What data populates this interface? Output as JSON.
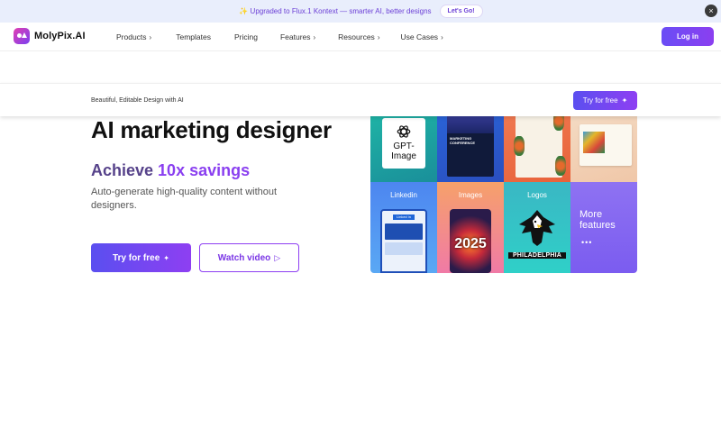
{
  "announcement": {
    "icon": "sparkles-icon",
    "text": "✨ Upgraded to Flux.1 Kontext — smarter AI, better designs",
    "cta": "Let's Go!",
    "close_icon": "close-icon"
  },
  "nav": {
    "brand": "MolyPix.AI",
    "items": [
      {
        "label": "Products",
        "has_chevron": true
      },
      {
        "label": "Templates",
        "has_chevron": false
      },
      {
        "label": "Pricing",
        "has_chevron": false
      },
      {
        "label": "Features",
        "has_chevron": true
      },
      {
        "label": "Resources",
        "has_chevron": true
      },
      {
        "label": "Use Cases",
        "has_chevron": true
      }
    ],
    "login": "Log in"
  },
  "sticky_bar": {
    "tagline": "Beautiful, Editable Design with AI",
    "cta": "Try for free"
  },
  "hero": {
    "title": "AI marketing designer",
    "subtitle_prefix": "Achieve ",
    "subtitle_accent": "10x savings",
    "description": "Auto-generate high-quality content without designers.",
    "primary_cta": "Try for free",
    "secondary_cta": "Watch video"
  },
  "grid": {
    "gpt_label": "GPT-Image",
    "conf_title": "MARKETING CONFERENCE",
    "linkedin_label": "Linkedin",
    "linkedin_header": "Linked in",
    "images_label": "Images",
    "images_year": "2025",
    "logos_label": "Logos",
    "logos_text": "PHILADELPHIA",
    "more_label": "More features",
    "more_dots": "•••"
  },
  "colors": {
    "accent": "#8a3ff0",
    "primary_gradient_start": "#5a4ff0",
    "announce_bg": "#e9eefc"
  }
}
